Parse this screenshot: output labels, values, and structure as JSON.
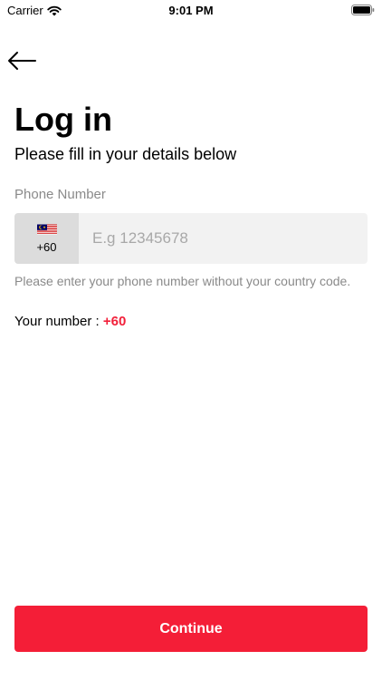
{
  "status_bar": {
    "carrier": "Carrier",
    "time": "9:01 PM"
  },
  "header": {
    "back_icon": "arrow-left-icon"
  },
  "page": {
    "title": "Log in",
    "subtitle": "Please fill in your details below"
  },
  "phone_field": {
    "label": "Phone Number",
    "country_flag_icon": "malaysia-flag-icon",
    "country_code": "+60",
    "value": "",
    "placeholder": "E.g 12345678",
    "helper": "Please enter your phone number without your country code."
  },
  "your_number": {
    "label": "Your number : ",
    "value": "+60"
  },
  "actions": {
    "continue_label": "Continue"
  },
  "colors": {
    "accent": "#f41e37",
    "country_picker_bg": "#dcdcdc",
    "input_bg": "#f2f2f2",
    "muted_text": "#8a8a8a"
  }
}
